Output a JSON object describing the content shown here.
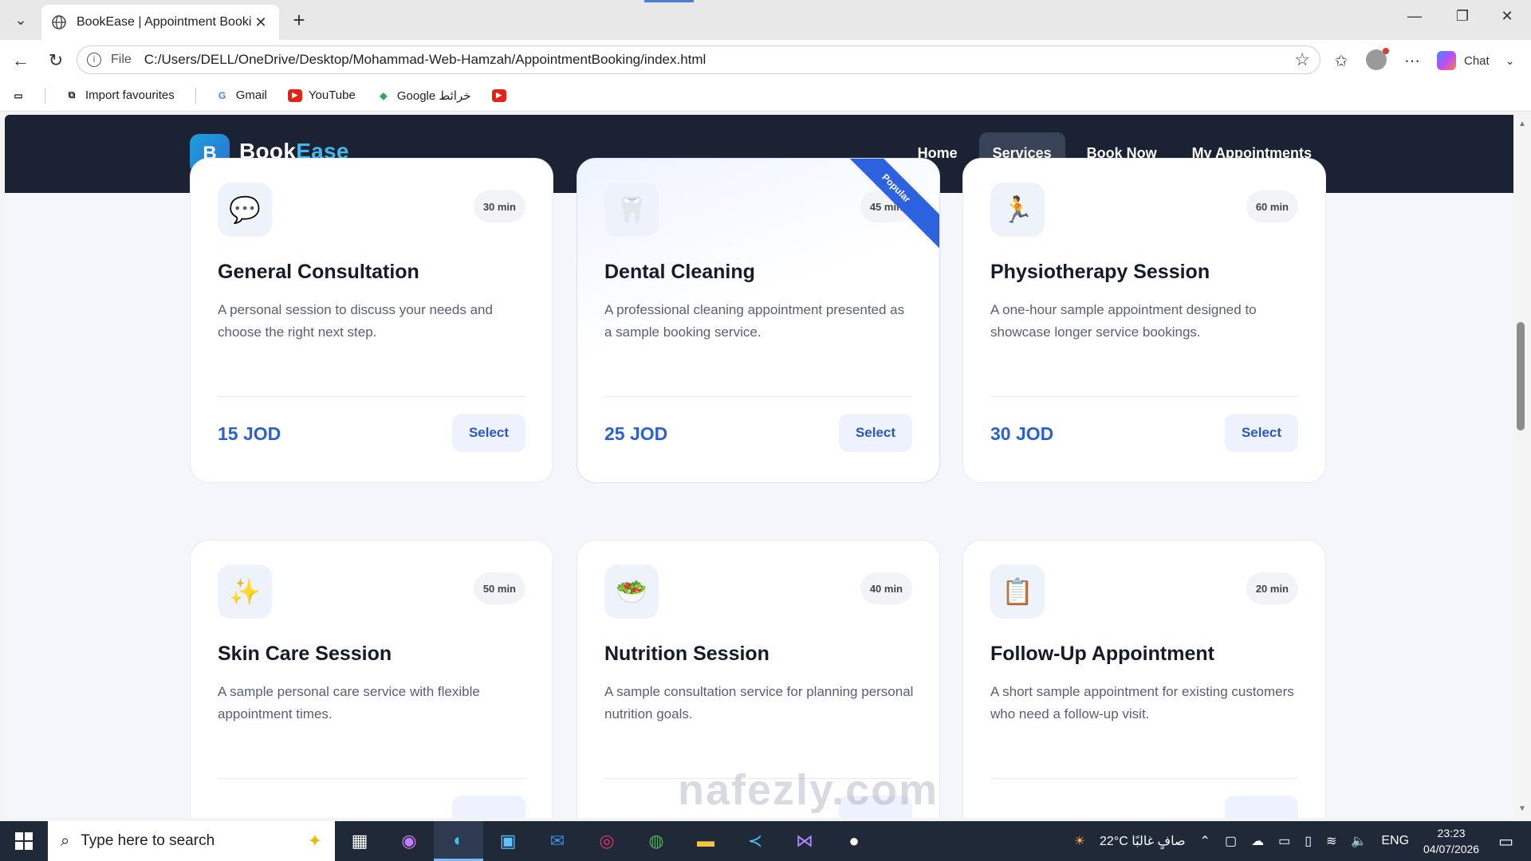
{
  "browser": {
    "tab_title": "BookEase | Appointment Booking",
    "file_label": "File",
    "url": "C:/Users/DELL/OneDrive/Desktop/Mohammad-Web-Hamzah/AppointmentBooking/index.html",
    "chat_label": "Chat",
    "favourites": [
      {
        "label": "Import favourites",
        "icon": "import-icon"
      },
      {
        "label": "Gmail",
        "icon": "google-icon"
      },
      {
        "label": "YouTube",
        "icon": "youtube-icon"
      },
      {
        "label": "Google خرائط",
        "icon": "maps-icon"
      }
    ]
  },
  "site": {
    "logo_letter": "B",
    "brand_part1": "Book",
    "brand_part2": "Ease",
    "nav": [
      {
        "label": "Home",
        "active": false
      },
      {
        "label": "Services",
        "active": true
      },
      {
        "label": "Book Now",
        "active": false
      },
      {
        "label": "My Appointments",
        "active": false
      }
    ],
    "services": [
      {
        "icon": "💬",
        "icon_name": "chat-bubble-icon",
        "duration": "30 min",
        "title": "General Consultation",
        "description": "A personal session to discuss your needs and choose the right next step.",
        "price": "15 JOD",
        "button": "Select"
      },
      {
        "icon": "🦷",
        "icon_name": "tooth-icon",
        "duration": "45 min",
        "title": "Dental Cleaning",
        "description": "A professional cleaning appointment presented as a sample booking service.",
        "price": "25 JOD",
        "button": "Select",
        "badge": "Popular"
      },
      {
        "icon": "🏃",
        "icon_name": "running-person-icon",
        "duration": "60 min",
        "title": "Physiotherapy Session",
        "description": "A one-hour sample appointment designed to showcase longer service bookings.",
        "price": "30 JOD",
        "button": "Select"
      },
      {
        "icon": "✨",
        "icon_name": "sparkles-icon",
        "duration": "50 min",
        "title": "Skin Care Session",
        "description": "A sample personal care service with flexible appointment times."
      },
      {
        "icon": "🥗",
        "icon_name": "salad-icon",
        "duration": "40 min",
        "title": "Nutrition Session",
        "description": "A sample consultation service for planning personal nutrition goals."
      },
      {
        "icon": "📋",
        "icon_name": "clipboard-icon",
        "duration": "20 min",
        "title": "Follow-Up Appointment",
        "description": "A short sample appointment for existing customers who need a follow-up visit."
      }
    ]
  },
  "watermark": "nafezly.com",
  "taskbar": {
    "search_placeholder": "Type here to search",
    "weather": "22°C صافٍ غالبًا",
    "language": "ENG",
    "time": "23:23",
    "date": "04/07/2026"
  },
  "colors": {
    "navbar": "#1b2233",
    "accent": "#2a63c9",
    "ribbon": "#2c61e0"
  }
}
